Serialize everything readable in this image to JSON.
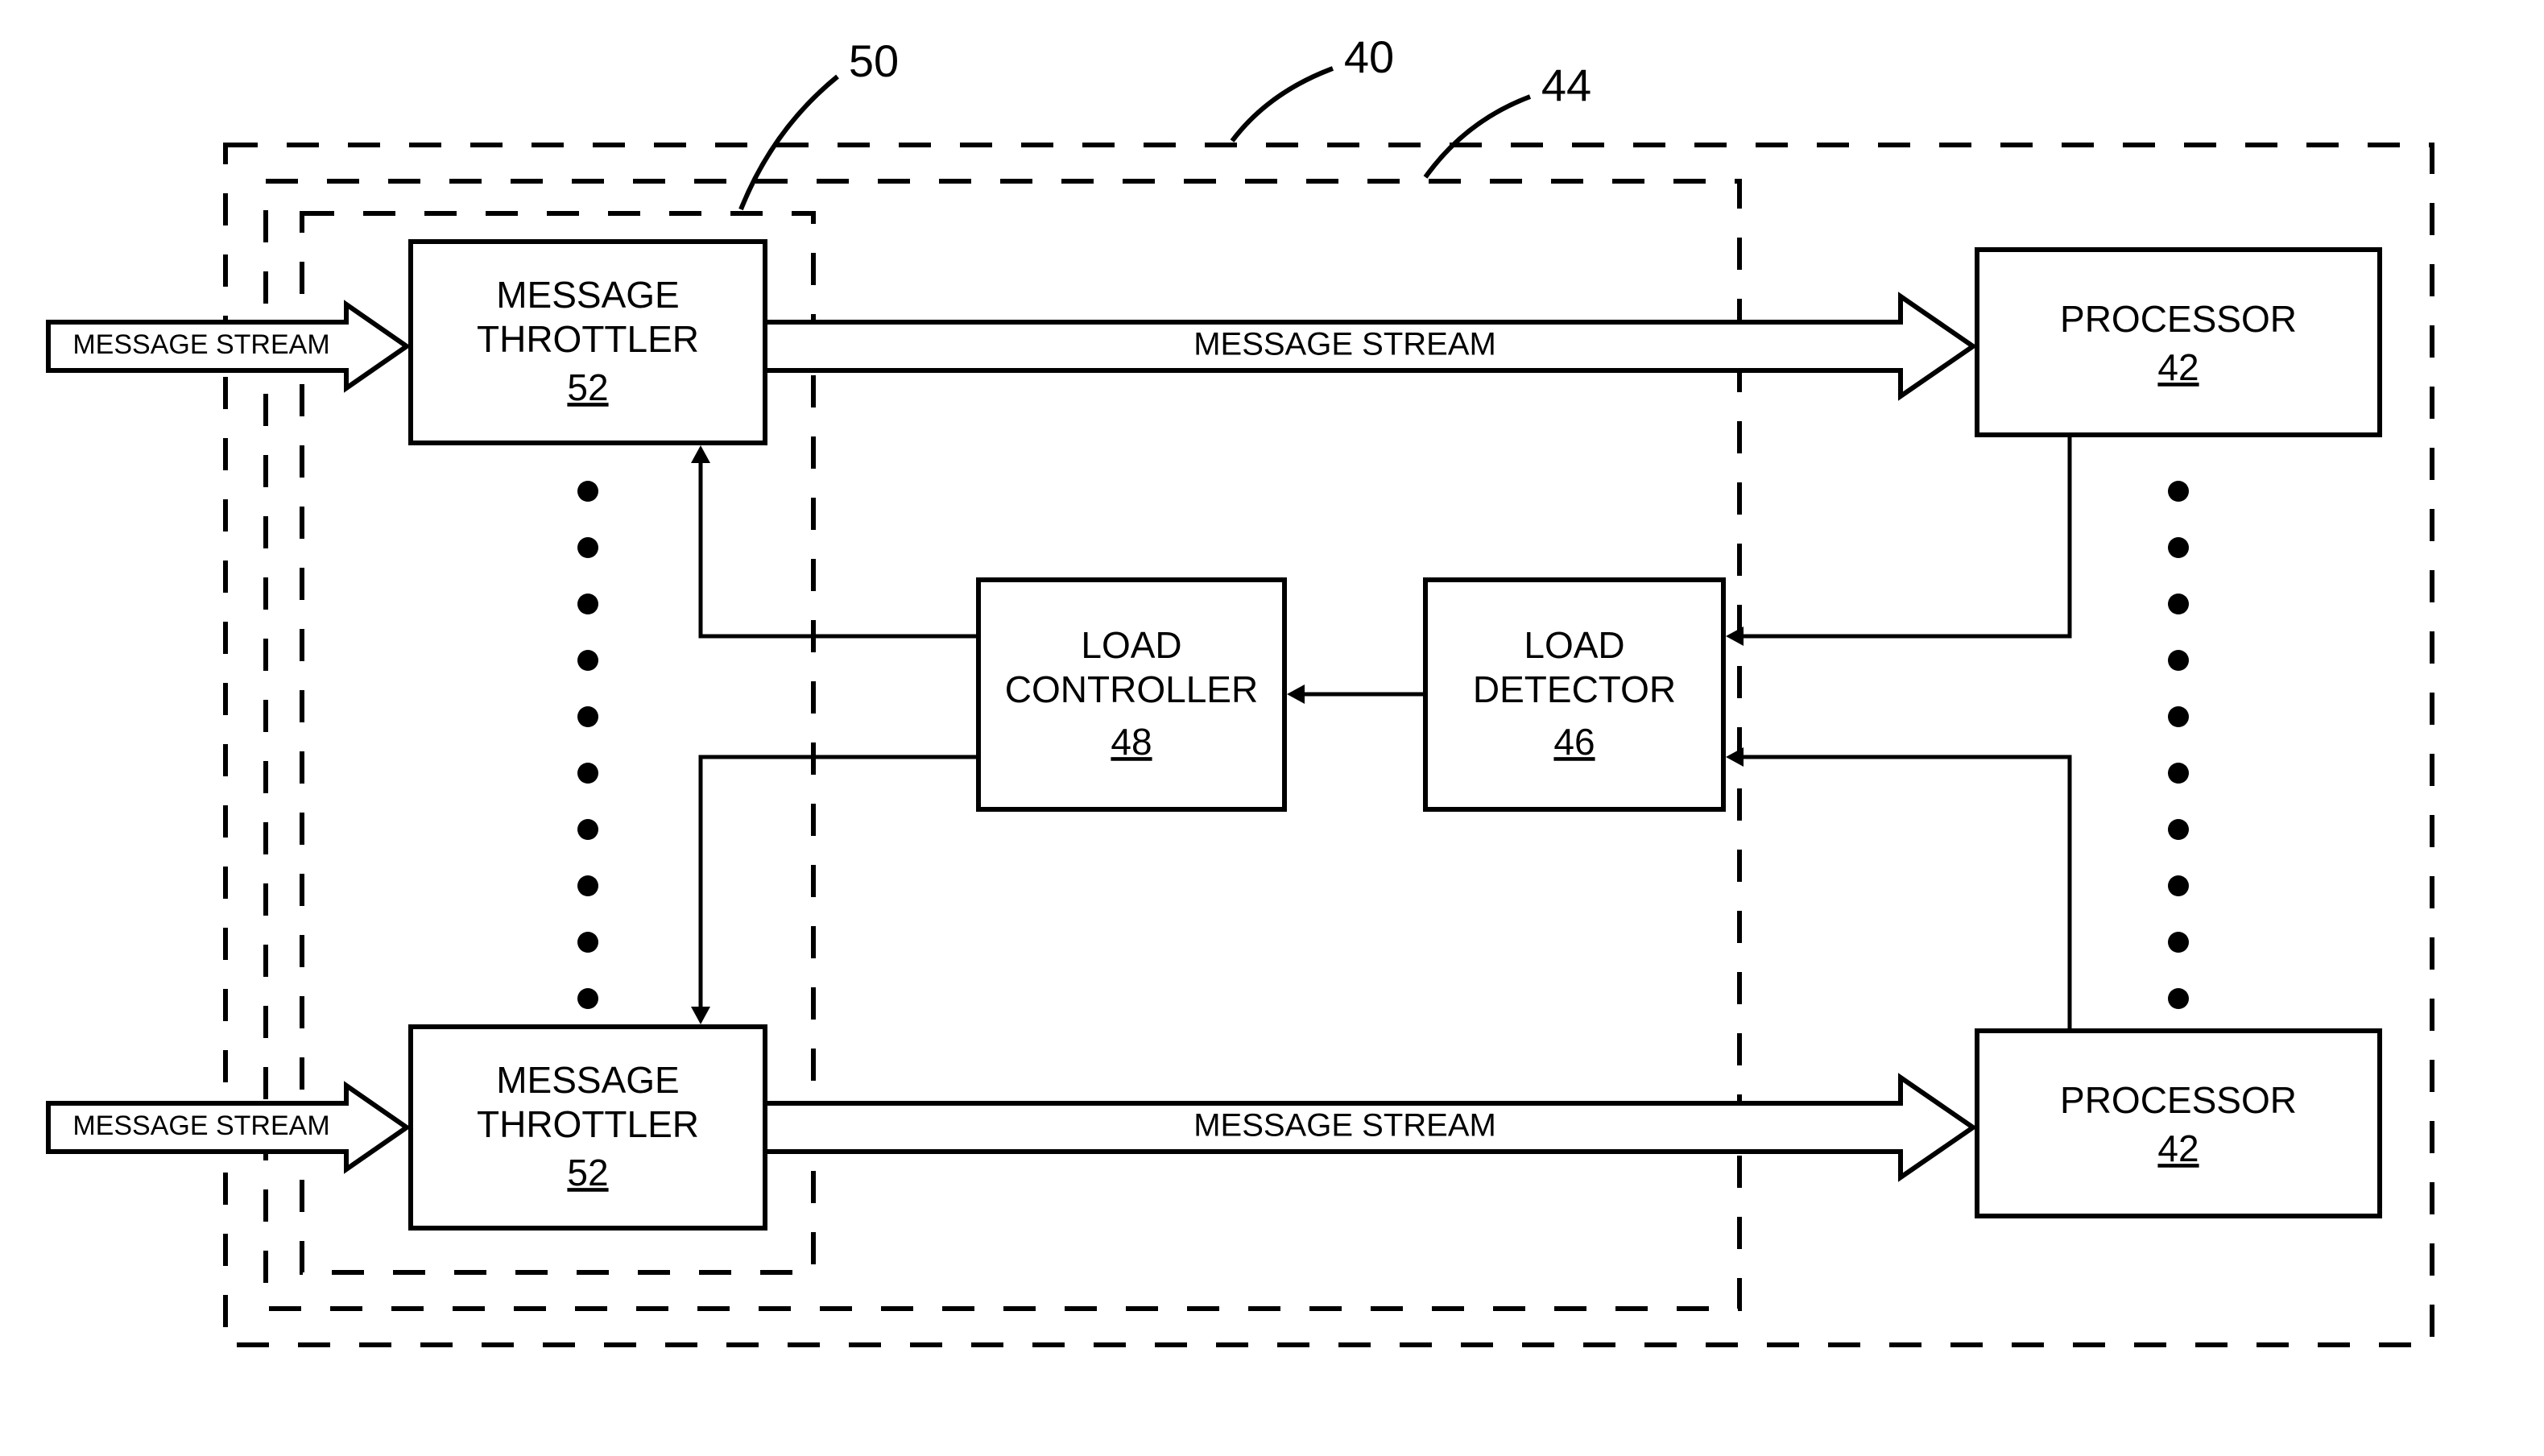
{
  "refs": {
    "outer": "40",
    "inner": "44",
    "throttler_boundary": "50"
  },
  "labels": {
    "message_stream": "MESSAGE STREAM",
    "throttler_title": "MESSAGE",
    "throttler_sub": "THROTTLER",
    "throttler_ref": "52",
    "processor_title": "PROCESSOR",
    "processor_ref": "42",
    "load_controller_title1": "LOAD",
    "load_controller_title2": "CONTROLLER",
    "load_controller_ref": "48",
    "load_detector_title1": "LOAD",
    "load_detector_title2": "DETECTOR",
    "load_detector_ref": "46"
  }
}
